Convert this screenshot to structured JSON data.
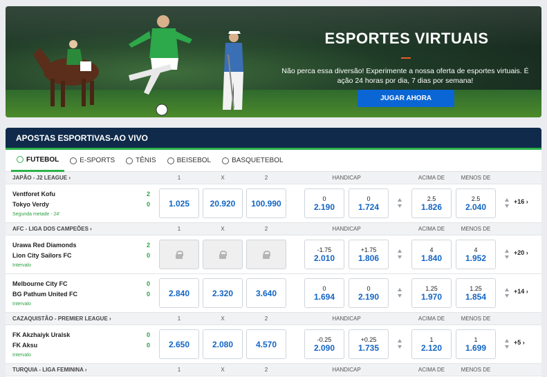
{
  "banner": {
    "title": "ESPORTES VIRTUAIS",
    "description": "Não perca essa diversão! Experimente a nossa oferta de esportes virtuais. É ação 24 horas por dia, 7 dias por semana!",
    "cta": "JUGAR AHORA",
    "accent_color": "#f05a28",
    "button_color": "#0a66d4"
  },
  "live": {
    "title": "APOSTAS ESPORTIVAS-AO VIVO",
    "tabs": [
      {
        "label": "FUTEBOL",
        "icon": "soccer-ball-icon",
        "active": true
      },
      {
        "label": "E-SPORTS",
        "icon": "headset-icon",
        "active": false
      },
      {
        "label": "TÊNIS",
        "icon": "tennis-ball-icon",
        "active": false
      },
      {
        "label": "BEISEBOL",
        "icon": "baseball-icon",
        "active": false
      },
      {
        "label": "BASQUETEBOL",
        "icon": "basketball-icon",
        "active": false
      }
    ],
    "columns": {
      "c1": "1",
      "cx": "X",
      "c2": "2",
      "handicap": "HANDICAP",
      "over": "ACIMA DE",
      "under": "MENOS DE"
    },
    "leagues": [
      {
        "name": "JAPÃO - J2 LEAGUE",
        "matches": [
          {
            "team1": "Ventforet Kofu",
            "team2": "Tokyo Verdy",
            "score1": "2",
            "score2": "0",
            "status": "Segunda metade - 24'",
            "odds": [
              "1.025",
              "20.920",
              "100.990"
            ],
            "locked": false,
            "hcp1_line": "0",
            "hcp1_val": "2.190",
            "hcp2_line": "0",
            "hcp2_val": "1.724",
            "over_line": "2.5",
            "over_val": "1.826",
            "under_line": "2.5",
            "under_val": "2.040",
            "more": "+16"
          }
        ]
      },
      {
        "name": "AFC - LIGA DOS CAMPEÕES",
        "matches": [
          {
            "team1": "Urawa Red Diamonds",
            "team2": "Lion City Sailors FC",
            "score1": "2",
            "score2": "0",
            "status": "Intervalo",
            "odds": [
              "",
              "",
              ""
            ],
            "locked": true,
            "hcp1_line": "-1.75",
            "hcp1_val": "2.010",
            "hcp2_line": "+1.75",
            "hcp2_val": "1.806",
            "over_line": "4",
            "over_val": "1.840",
            "under_line": "4",
            "under_val": "1.952",
            "more": "+20"
          },
          {
            "team1": "Melbourne City FC",
            "team2": "BG Pathum United FC",
            "score1": "0",
            "score2": "0",
            "status": "Intervalo",
            "odds": [
              "2.840",
              "2.320",
              "3.640"
            ],
            "locked": false,
            "hcp1_line": "0",
            "hcp1_val": "1.694",
            "hcp2_line": "0",
            "hcp2_val": "2.190",
            "over_line": "1.25",
            "over_val": "1.970",
            "under_line": "1.25",
            "under_val": "1.854",
            "more": "+14"
          }
        ]
      },
      {
        "name": "CAZAQUISTÃO - PREMIER LEAGUE",
        "matches": [
          {
            "team1": "FK Akzhaiyk Uralsk",
            "team2": "FK Aksu",
            "score1": "0",
            "score2": "0",
            "status": "Intervalo",
            "odds": [
              "2.650",
              "2.080",
              "4.570"
            ],
            "locked": false,
            "hcp1_line": "-0.25",
            "hcp1_val": "2.090",
            "hcp2_line": "+0.25",
            "hcp2_val": "1.735",
            "over_line": "1",
            "over_val": "2.120",
            "under_line": "1",
            "under_val": "1.699",
            "more": "+5"
          }
        ]
      },
      {
        "name": "TURQUIA - LIGA FEMININA",
        "matches": []
      }
    ]
  }
}
